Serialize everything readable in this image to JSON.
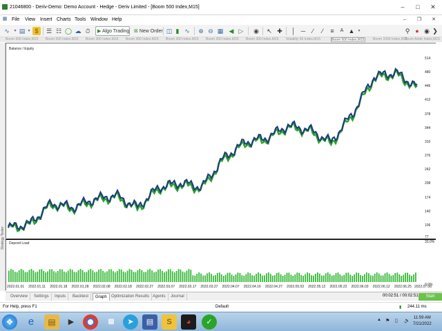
{
  "window": {
    "title": "21046800 - Deriv-Demo: Demo Account - Hedge - Deriv Limited - [Boom 500 Index,M15]"
  },
  "menu": [
    "File",
    "View",
    "Insert",
    "Charts",
    "Tools",
    "Window",
    "Help"
  ],
  "toolbar": {
    "algo_trading": "Algo Trading",
    "new_order": "New Order"
  },
  "chart_tabs": [
    "Boom 500 Index,M15",
    "Boom 500 Index,M15",
    "Boom 300 Index,M15",
    "Boom 300 Index,M15",
    "Boom 300 Index,M15",
    "Boom 300 Index,M15",
    "Boom 300 Index,M15",
    "Volatility 50 Index,M15",
    "Boom 500 Index,M15",
    "Boom 1000 Index,M15",
    "Boom Arbitr Index,M15"
  ],
  "chart": {
    "legend": "Balance / Equity",
    "sub_legend": "Deposit Load",
    "y_ticks": [
      "514",
      "480",
      "446",
      "412",
      "378",
      "344",
      "310",
      "276",
      "242",
      "208",
      "174",
      "140",
      "106",
      "77"
    ],
    "sub_y_ticks": [
      "33.0%",
      "0.0%"
    ],
    "x_ticks": [
      "2022.01.01",
      "2022.01.11",
      "2022.01.18",
      "2022.01.28",
      "2022.02.08",
      "2022.02.18",
      "2022.02.27",
      "2022.03.07",
      "2022.03.17",
      "2022.03.27",
      "2022.04.07",
      "2022.04.16",
      "2022.04.27",
      "2022.05.03",
      "2022.05.12",
      "2022.05.22",
      "2022.06.03",
      "2022.06.12",
      "2022.06.25",
      "2022.07.06"
    ]
  },
  "chart_data": {
    "type": "line",
    "x": [
      "2022.01.01",
      "2022.01.11",
      "2022.01.18",
      "2022.01.28",
      "2022.02.08",
      "2022.02.18",
      "2022.02.27",
      "2022.03.07",
      "2022.03.17",
      "2022.03.27",
      "2022.04.07",
      "2022.04.16",
      "2022.04.27",
      "2022.05.03",
      "2022.05.12",
      "2022.05.22",
      "2022.06.03",
      "2022.06.12",
      "2022.06.25",
      "2022.07.06"
    ],
    "series": [
      {
        "name": "Balance",
        "color": "#1f3f7a",
        "values": [
          100,
          110,
          160,
          150,
          170,
          180,
          150,
          200,
          210,
          200,
          270,
          310,
          320,
          350,
          340,
          310,
          380,
          470,
          480,
          445
        ]
      },
      {
        "name": "Equity",
        "color": "#2aa52a",
        "values": [
          98,
          107,
          157,
          147,
          166,
          176,
          146,
          196,
          205,
          196,
          266,
          306,
          316,
          346,
          336,
          305,
          376,
          466,
          476,
          440
        ]
      }
    ],
    "deposit_load_range": [
      "0.0%",
      "33.0%"
    ],
    "ylim": [
      77,
      514
    ]
  },
  "bottom_tabs": [
    "Overview",
    "Settings",
    "Inputs",
    "Backtest",
    "Graph",
    "Optimization Results",
    "Agents",
    "Journal"
  ],
  "active_bottom_tab": "Graph",
  "timer": "00:02:51 / 00:02:51",
  "start_label": "Start",
  "statusbar": {
    "help": "For Help, press F1",
    "profile": "Default",
    "ping": "244.11 ms"
  },
  "side_label": "Strategy Tester",
  "taskbar": {
    "time": "11:59 AM",
    "date": "7/21/2022"
  }
}
